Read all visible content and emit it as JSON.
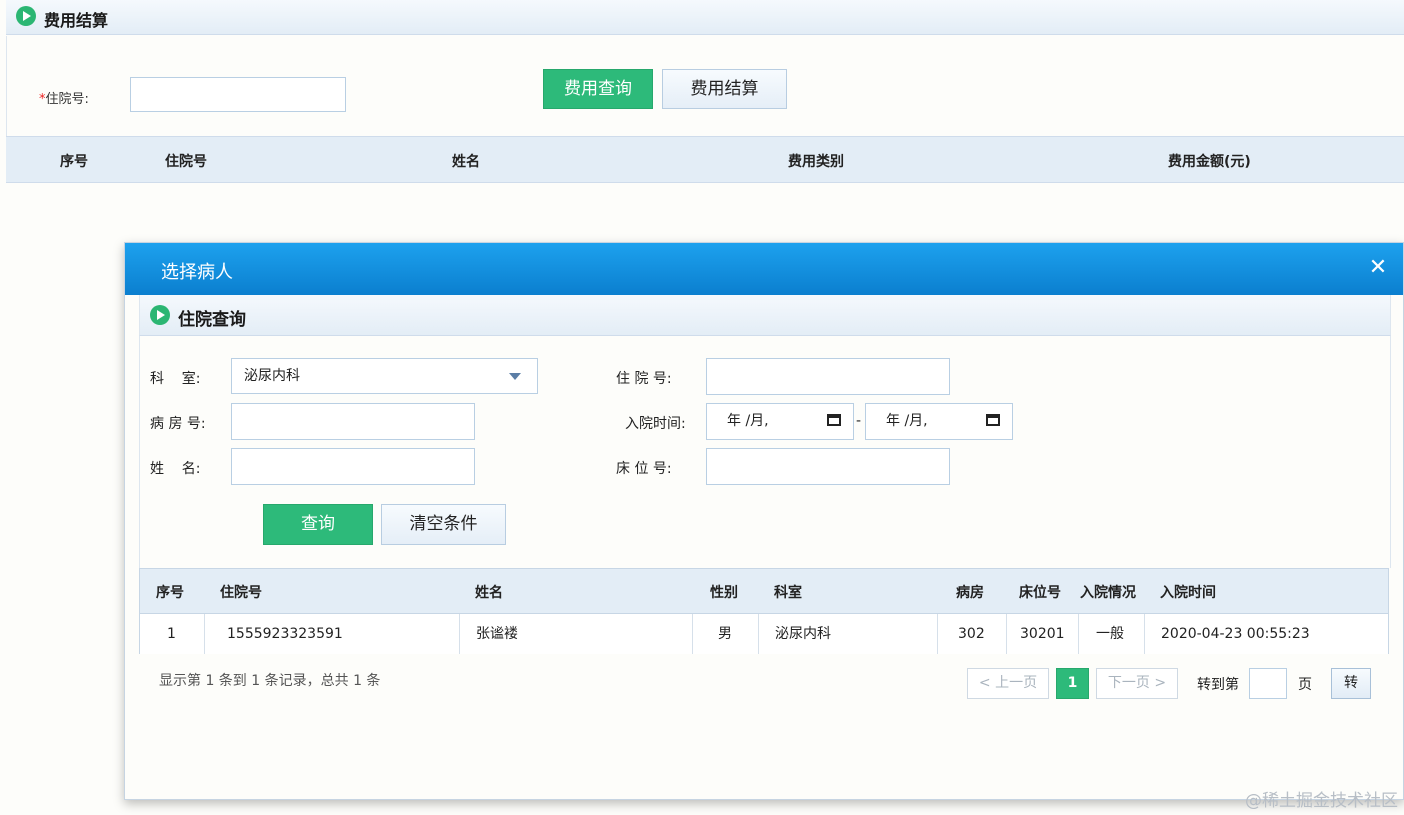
{
  "page": {
    "title": "费用结算",
    "inpatient_label": "住院号:",
    "inpatient_value": "",
    "query_button": "费用查询",
    "settle_button": "费用结算",
    "table_headers": [
      "序号",
      "住院号",
      "姓名",
      "费用类别",
      "费用金额(元)"
    ]
  },
  "modal": {
    "title": "选择病人",
    "close_glyph": "✕",
    "section_title": "住院查询",
    "form": {
      "dept_label": "科    室:",
      "dept_value": "泌尿内科",
      "ward_label": "病 房 号:",
      "name_label": "姓    名:",
      "inpatient_label": "住 院 号:",
      "admit_time_label": "入院时间:",
      "date_from": "年 /月,",
      "date_to": "年 /月,",
      "date_separator": "-",
      "bed_label": "床 位 号:"
    },
    "search_button": "查询",
    "clear_button": "清空条件",
    "table": {
      "headers": [
        "序号",
        "住院号",
        "姓名",
        "性别",
        "科室",
        "病房",
        "床位号",
        "入院情况",
        "入院时间"
      ],
      "rows": [
        [
          "1",
          "1555923323591",
          "张谧褛",
          "男",
          "泌尿内科",
          "302",
          "30201",
          "一般",
          "2020-04-23 00:55:23"
        ]
      ]
    },
    "summary": "显示第 1 条到 1 条记录，总共 1 条",
    "pagination": {
      "prev": "< 上一页",
      "current": "1",
      "next": "下一页 >",
      "goto_prefix": "转到第",
      "goto_suffix": "页",
      "goto_button": "转"
    }
  },
  "watermark": "@稀土掘金技术社区",
  "colors": {
    "primary_green": "#2dba7a",
    "modal_title_blue": "#0b7fcf",
    "header_bg": "#e3edf6"
  }
}
